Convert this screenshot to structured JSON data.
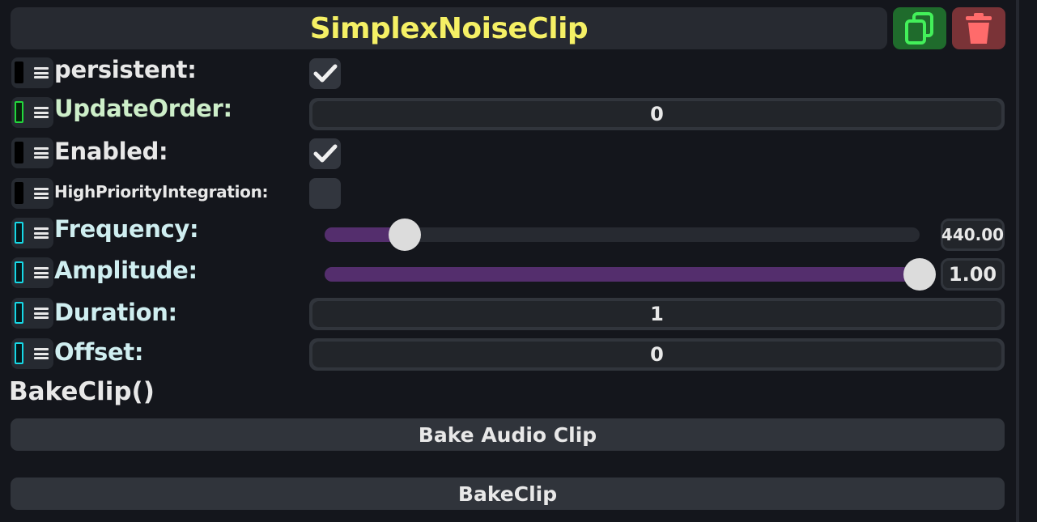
{
  "header": {
    "title": "SimplexNoiseClip",
    "copy_icon": "copy-icon",
    "delete_icon": "trash-icon",
    "title_color": "#f5f065"
  },
  "fields": [
    {
      "label": "persistent:",
      "type": "checkbox",
      "checked": true,
      "indicator": "black"
    },
    {
      "label": "UpdateOrder:",
      "type": "number",
      "value": "0",
      "indicator": "green"
    },
    {
      "label": "Enabled:",
      "type": "checkbox",
      "checked": true,
      "indicator": "black"
    },
    {
      "label": "HighPriorityIntegration:",
      "type": "checkbox",
      "checked": false,
      "indicator": "black"
    },
    {
      "label": "Frequency:",
      "type": "slider",
      "value": "440.00",
      "fraction": 0.11,
      "indicator": "cyan"
    },
    {
      "label": "Amplitude:",
      "type": "slider",
      "value": "1.00",
      "fraction": 1.0,
      "indicator": "cyan"
    },
    {
      "label": "Duration:",
      "type": "number",
      "value": "1",
      "indicator": "cyan"
    },
    {
      "label": "Offset:",
      "type": "number",
      "value": "0",
      "indicator": "cyan"
    }
  ],
  "method": {
    "label": "BakeClip()",
    "buttons": [
      "Bake Audio Clip",
      "BakeClip"
    ]
  },
  "colors": {
    "background": "#14161c",
    "slider_fill": "#542e6d",
    "indicator_green": "#22d83c",
    "indicator_cyan": "#16d8e6",
    "copy_button": "#1f6b2c",
    "delete_button": "#7a3337"
  }
}
